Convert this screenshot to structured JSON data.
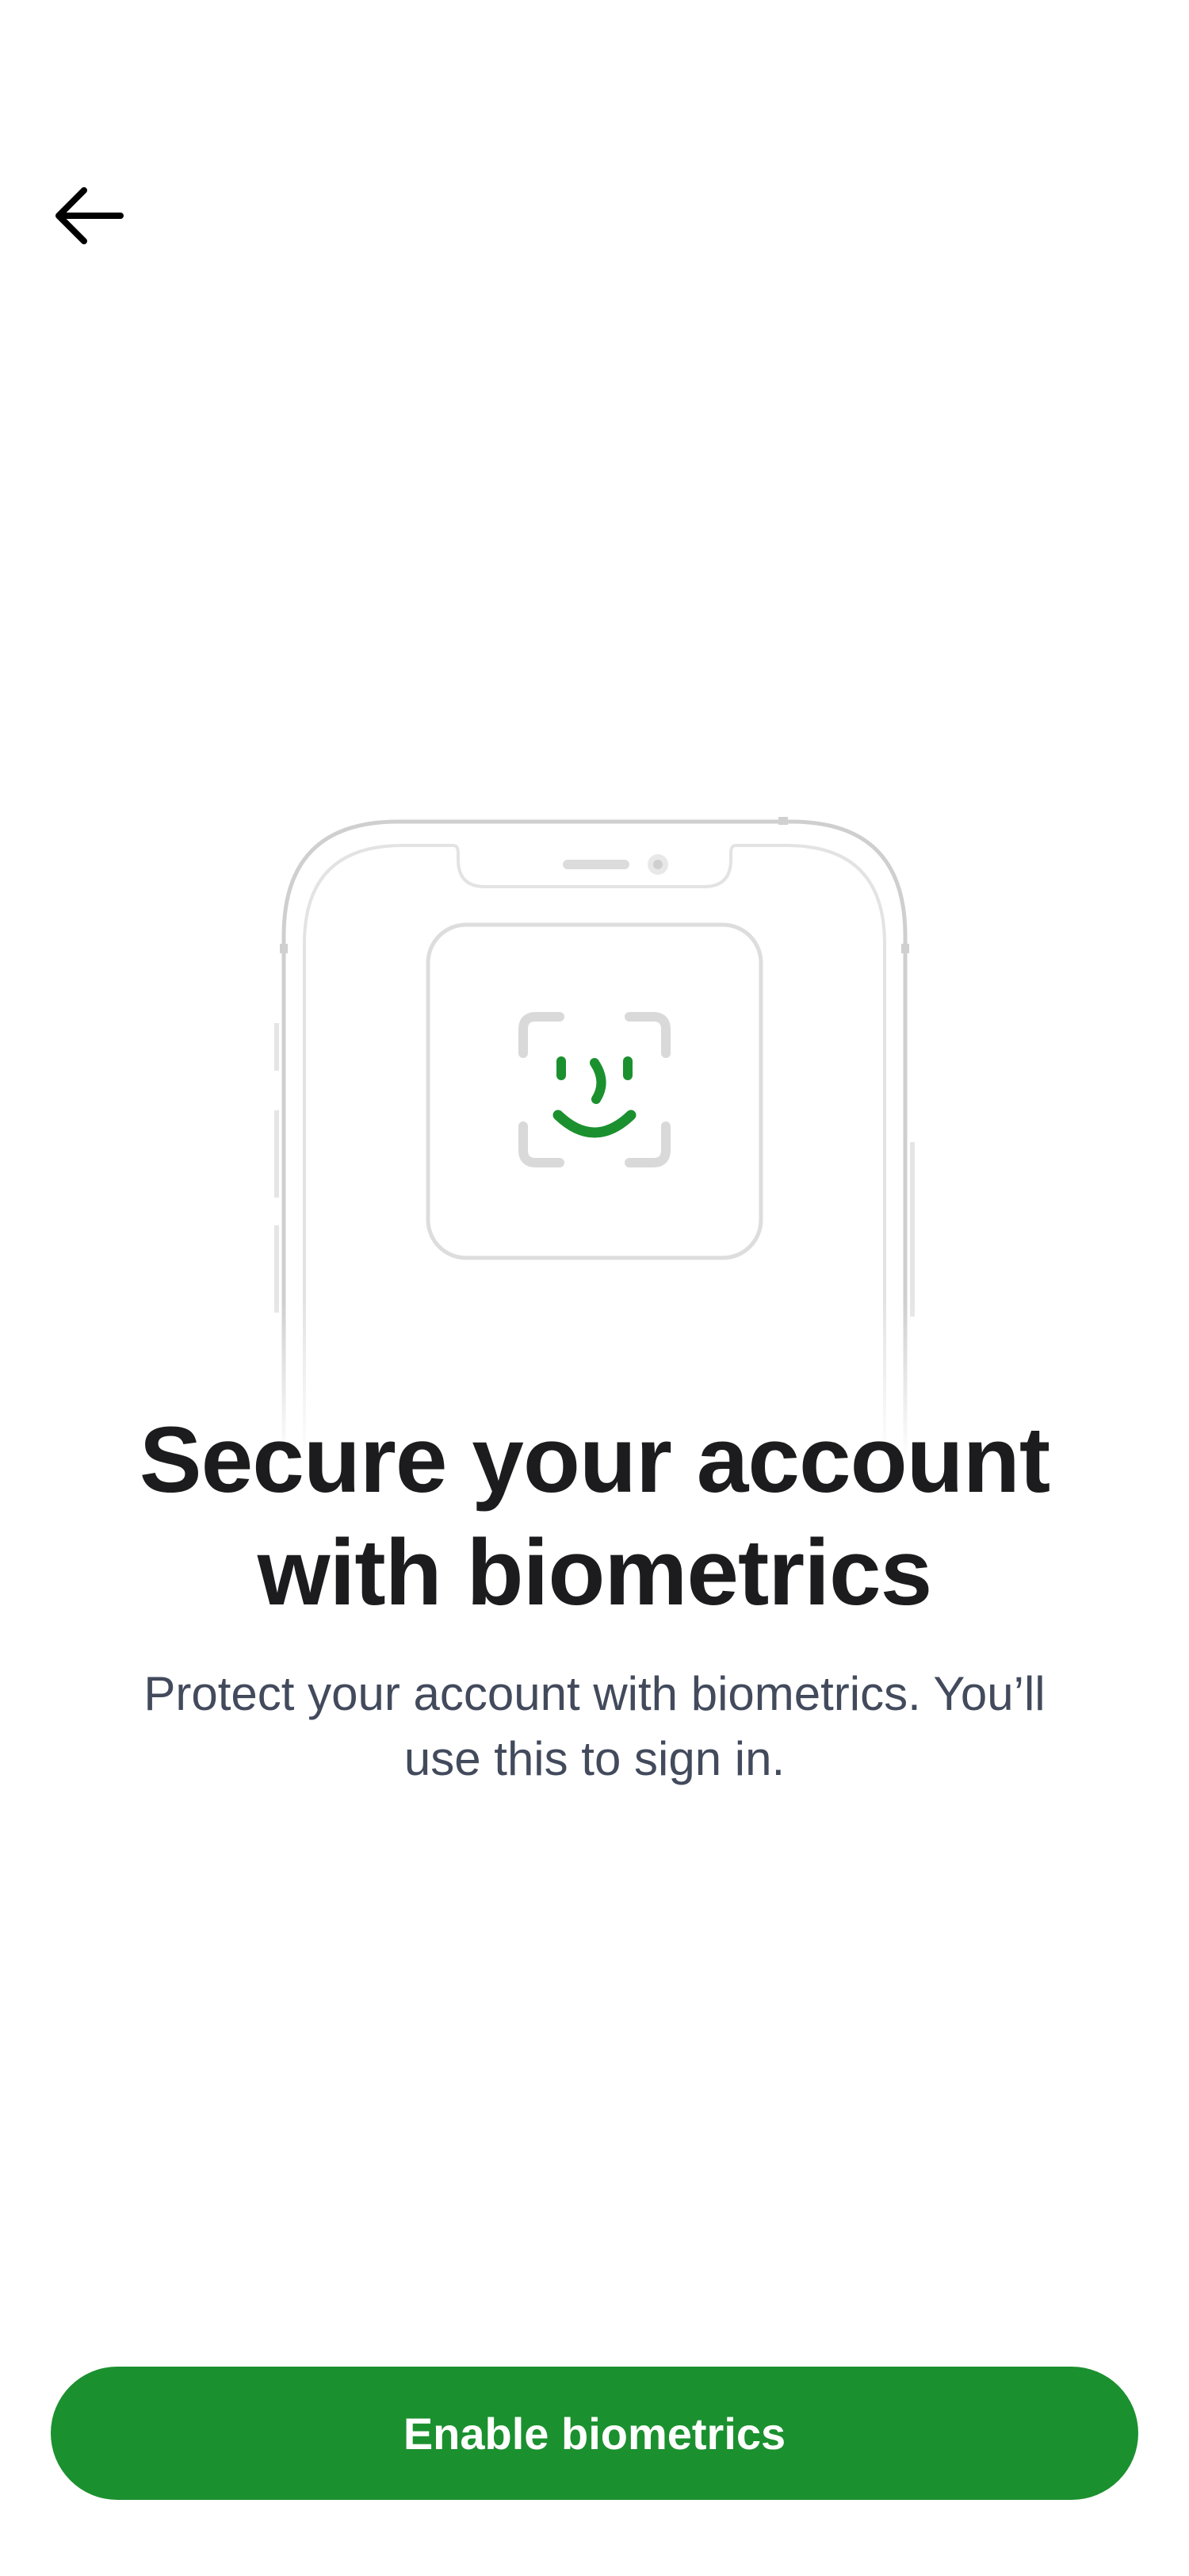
{
  "header": {
    "back_icon": "arrow-left-icon"
  },
  "illustration": {
    "device": "phone-outline",
    "icon": "face-id-icon",
    "accent_color": "#1b902f",
    "frame_color": "#d9d9d9"
  },
  "content": {
    "title_line1": "Secure your account",
    "title_line2": "with biometrics",
    "description_line1": "Protect your account with biometrics. You’ll",
    "description_line2": "use this to sign in."
  },
  "actions": {
    "primary_label": "Enable biometrics",
    "primary_color": "#1b902f"
  }
}
